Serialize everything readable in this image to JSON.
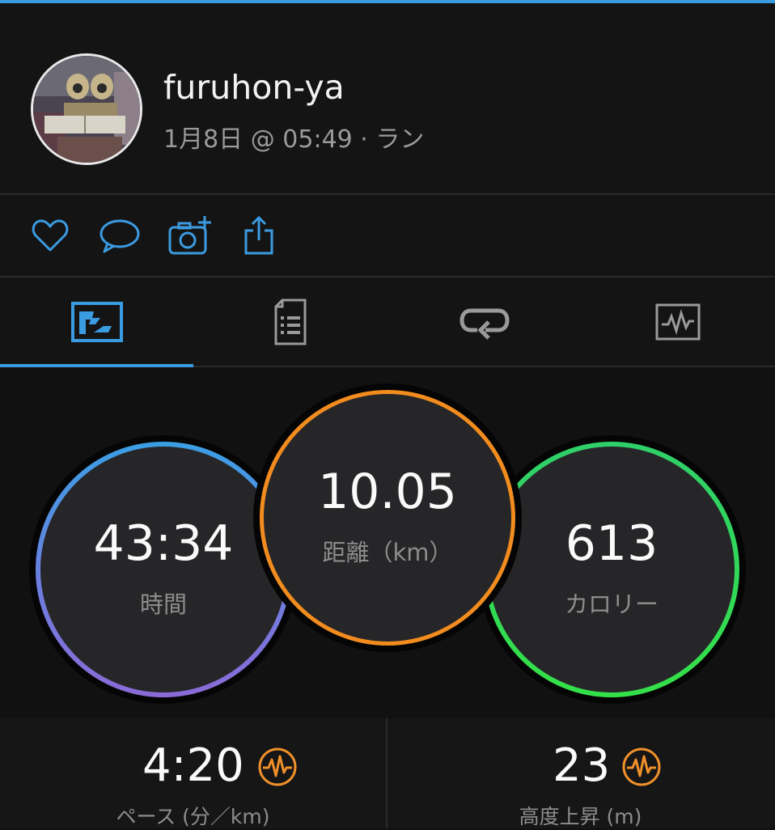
{
  "header": {
    "username": "furuhon-ya",
    "date": "1月8日",
    "at": "@",
    "time": "05:49",
    "sep": "·",
    "activity": "ラン"
  },
  "actions": [
    {
      "icon": "heart-icon"
    },
    {
      "icon": "comment-icon"
    },
    {
      "icon": "add-photo-icon"
    },
    {
      "icon": "share-icon"
    }
  ],
  "tabs": [
    {
      "icon": "map-overview-icon",
      "active": true
    },
    {
      "icon": "details-list-icon",
      "active": false
    },
    {
      "icon": "laps-icon",
      "active": false
    },
    {
      "icon": "chart-icon",
      "active": false
    }
  ],
  "summary": {
    "time": {
      "value": "43:34",
      "label": "時間"
    },
    "distance": {
      "value": "10.05",
      "label": "距離（km）"
    },
    "calories": {
      "value": "613",
      "label": "カロリー"
    }
  },
  "stats": {
    "pace": {
      "value": "4:20",
      "label": "ペース (分／km)"
    },
    "elevation": {
      "value": "23",
      "label": "高度上昇 (m)"
    }
  },
  "colors": {
    "accent": "#3b9be0",
    "time_ring_top": "#3a9fe4",
    "time_ring_bottom": "#8a6ad6",
    "distance_ring": "#f28c1e",
    "calories_ring": "#2fd65a",
    "hr_icon": "#f0902a"
  }
}
